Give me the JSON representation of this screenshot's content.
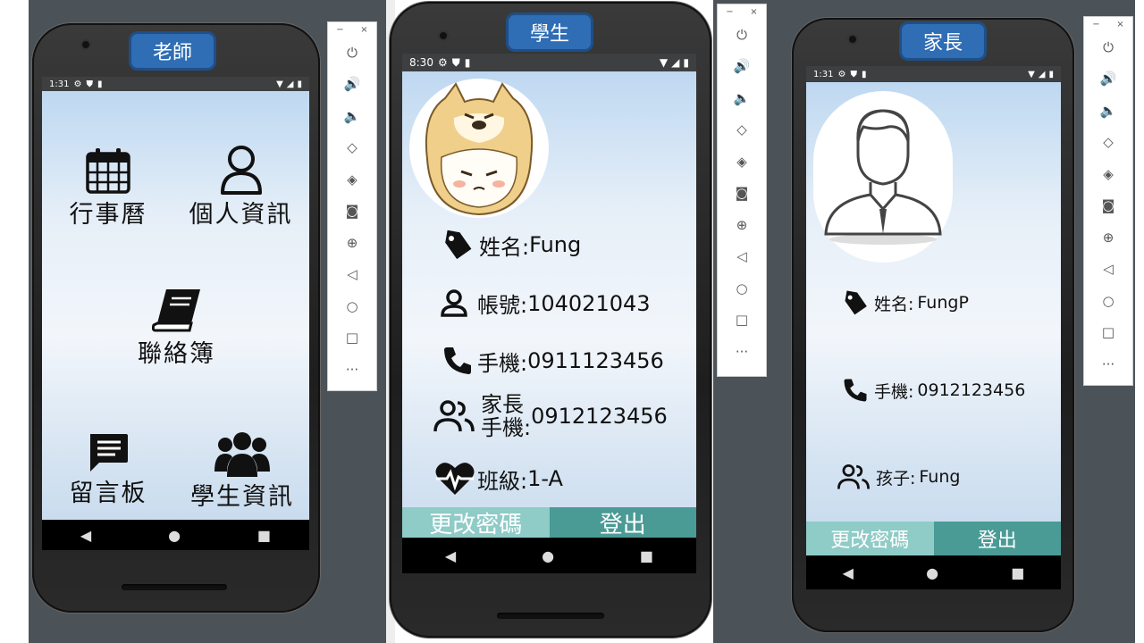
{
  "colors": {
    "label_bg": "#2f6db5",
    "btn_left": "#8fcbc7",
    "btn_right": "#4a9a96",
    "desktop": "#4c5358"
  },
  "teacher": {
    "role_label": "老師",
    "status_time": "1:31",
    "tiles": [
      {
        "label": "行事曆",
        "icon": "calendar-icon"
      },
      {
        "label": "個人資訊",
        "icon": "person-icon"
      },
      {
        "label": "聯絡簿",
        "icon": "book-icon"
      },
      {
        "label": "留言板",
        "icon": "message-icon"
      },
      {
        "label": "學生資訊",
        "icon": "group-icon"
      }
    ]
  },
  "student": {
    "role_label": "學生",
    "status_time": "8:30",
    "avatar": "shiba-avatar",
    "rows": [
      {
        "label": "姓名:",
        "value": "Fung",
        "icon": "tag-icon"
      },
      {
        "label": "帳號:",
        "value": "104021043",
        "icon": "account-icon"
      },
      {
        "label": "手機:",
        "value": "0911123456",
        "icon": "phone-icon"
      },
      {
        "label_line1": "家長",
        "label_line2": "手機:",
        "value": "0912123456",
        "icon": "people-icon"
      },
      {
        "label": "班級:",
        "value": "1-A",
        "icon": "heartbeat-icon"
      }
    ],
    "change_password": "更改密碼",
    "logout": "登出"
  },
  "parent": {
    "role_label": "家長",
    "status_time": "1:31",
    "avatar": "man-avatar",
    "rows": [
      {
        "label": "姓名:",
        "value": "FungP",
        "icon": "tag-icon"
      },
      {
        "label": "手機:",
        "value": "0912123456",
        "icon": "phone-icon"
      },
      {
        "label": "孩子:",
        "value": "Fung",
        "icon": "people-icon"
      }
    ],
    "change_password": "更改密碼",
    "logout": "登出"
  },
  "toolbar": {
    "minimize": "−",
    "close": "×",
    "more": "···"
  }
}
